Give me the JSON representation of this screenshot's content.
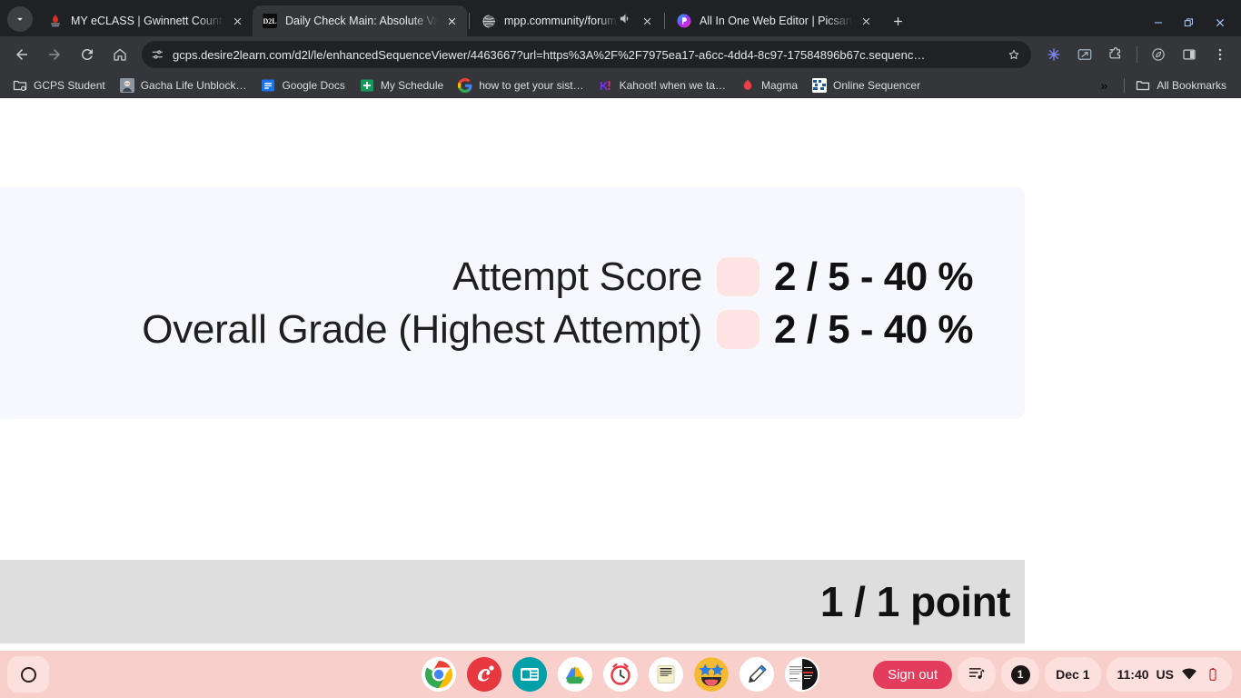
{
  "window": {
    "controls": [
      {
        "name": "minimize",
        "glyph": "–"
      },
      {
        "name": "restore",
        "glyph": "❐"
      },
      {
        "name": "close",
        "glyph": "✕"
      }
    ]
  },
  "tabs": [
    {
      "title": "MY eCLASS | Gwinnett County P",
      "favicon": "eclass-favicon",
      "active": false,
      "audio": false
    },
    {
      "title": "Daily Check Main: Absolute Val",
      "favicon": "d2l-favicon",
      "active": true,
      "audio": false
    },
    {
      "title": "mpp.community/forum/as",
      "favicon": "globe-favicon",
      "active": false,
      "audio": true
    },
    {
      "title": "All In One Web Editor | Picsart",
      "favicon": "picsart-favicon",
      "active": false,
      "audio": false
    }
  ],
  "toolbar": {
    "back": "back-arrow",
    "forward": "forward-arrow",
    "reload": "reload",
    "home": "home",
    "url": "gcps.desire2learn.com/d2l/le/enhancedSequenceViewer/4463667?url=https%3A%2F%2F7975ea17-a6cc-4dd4-8c97-17584896b67c.sequenc…",
    "site_settings_icon": "tune-icon",
    "bookmark_star": "star-outline",
    "right_icons": [
      "gemini-icon",
      "screencast-icon",
      "extensions-icon",
      "energy-saver-icon",
      "side-panel-icon",
      "more-menu-icon"
    ]
  },
  "bookmarks": {
    "items": [
      {
        "label": "GCPS Student",
        "icon": "folder-settings-icon"
      },
      {
        "label": "Gacha Life Unblock…",
        "icon": "gacha-icon"
      },
      {
        "label": "Google Docs",
        "icon": "docs-icon"
      },
      {
        "label": "My Schedule",
        "icon": "sheets-icon"
      },
      {
        "label": "how to get your sist…",
        "icon": "google-icon"
      },
      {
        "label": "Kahoot! when we ta…",
        "icon": "kahoot-icon"
      },
      {
        "label": "Magma",
        "icon": "magma-icon"
      },
      {
        "label": "Online Sequencer",
        "icon": "sequencer-icon"
      }
    ],
    "overflow_glyph": "»",
    "all_bookmarks_label": "All Bookmarks",
    "all_bookmarks_icon": "folder-icon"
  },
  "page": {
    "scores": [
      {
        "label": "Attempt Score",
        "value": "2 / 5 - 40 %",
        "badge_color": "#fde3e1"
      },
      {
        "label": "Overall Grade (Highest Attempt)",
        "value": "2 / 5 - 40 %",
        "badge_color": "#fde3e1"
      }
    ],
    "points": {
      "value": "1 / 1 point"
    },
    "panel_bg": "#f7f8fd",
    "points_bg": "#dedede"
  },
  "shelf": {
    "launcher_icon": "launcher-circle-icon",
    "apps": [
      {
        "name": "chrome-app-icon",
        "running": true
      },
      {
        "name": "canva-app-icon",
        "running": false
      },
      {
        "name": "slides-news-app-icon",
        "running": false
      },
      {
        "name": "google-drive-app-icon",
        "running": false
      },
      {
        "name": "clock-app-icon",
        "running": false
      },
      {
        "name": "notepad-app-icon",
        "running": false
      },
      {
        "name": "emoji-app-icon",
        "running": false
      },
      {
        "name": "pencil-app-icon",
        "running": false
      },
      {
        "name": "document-thumbnail-icon",
        "running": false
      }
    ],
    "sign_out_label": "Sign out",
    "media_icon": "playlist-music-icon",
    "notification_count": "1",
    "date": "Dec 1",
    "time": "11:40",
    "locale": "US",
    "wifi_icon": "wifi-icon",
    "battery_icon": "battery-low-icon",
    "accent": "#e33c5c",
    "background": "#f8cfcb"
  }
}
